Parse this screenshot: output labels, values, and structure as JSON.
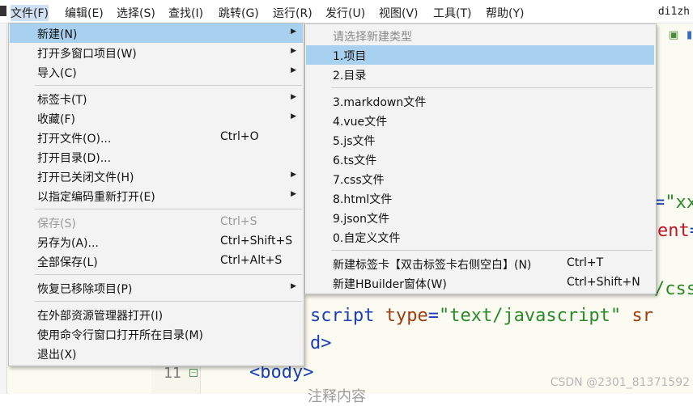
{
  "menubar": {
    "items": [
      {
        "label": "文件(F)"
      },
      {
        "label": "编辑(E)"
      },
      {
        "label": "选择(S)"
      },
      {
        "label": "查找(I)"
      },
      {
        "label": "跳转(G)"
      },
      {
        "label": "运行(R)"
      },
      {
        "label": "发行(U)"
      },
      {
        "label": "视图(V)"
      },
      {
        "label": "工具(T)"
      },
      {
        "label": "帮助(Y)"
      }
    ],
    "user": "di1zh"
  },
  "file_menu": {
    "items": [
      {
        "label": "新建(N)"
      },
      {
        "label": "打开多窗口项目(W)"
      },
      {
        "label": "导入(C)"
      },
      {
        "label": "标签卡(T)"
      },
      {
        "label": "收藏(F)"
      },
      {
        "label": "打开文件(O)...",
        "shortcut": "Ctrl+O"
      },
      {
        "label": "打开目录(D)..."
      },
      {
        "label": "打开已关闭文件(H)"
      },
      {
        "label": "以指定编码重新打开(E)"
      },
      {
        "label": "保存(S)",
        "shortcut": "Ctrl+S"
      },
      {
        "label": "另存为(A)...",
        "shortcut": "Ctrl+Shift+S"
      },
      {
        "label": "全部保存(L)",
        "shortcut": "Ctrl+Alt+S"
      },
      {
        "label": "恢复已移除项目(P)"
      },
      {
        "label": "在外部资源管理器打开(I)"
      },
      {
        "label": "使用命令行窗口打开所在目录(M)"
      },
      {
        "label": "退出(X)"
      }
    ]
  },
  "new_submenu": {
    "items": [
      {
        "label": "请选择新建类型"
      },
      {
        "label": "1.项目"
      },
      {
        "label": "2.目录"
      },
      {
        "label": "3.markdown文件"
      },
      {
        "label": "4.vue文件"
      },
      {
        "label": "5.js文件"
      },
      {
        "label": "6.ts文件"
      },
      {
        "label": "7.css文件"
      },
      {
        "label": "8.html文件"
      },
      {
        "label": "9.json文件"
      },
      {
        "label": "0.自定义文件"
      },
      {
        "label": "新建标签卡【双击标签卡右侧空白】(N)",
        "shortcut": "Ctrl+T"
      },
      {
        "label": "新建HBuilder窗体(W)",
        "shortcut": "Ctrl+Shift+N"
      }
    ]
  },
  "editor": {
    "frag_xx_eq": "=",
    "frag_xx_str": "\"xx",
    "frag_ent": "ent",
    "frag_ent_eq": "=",
    "frag_css": "/css",
    "script_kw": "script",
    "type_attr": "type",
    "type_eq": "=",
    "type_val": "\"text/javascript\"",
    "src_frag": "sr",
    "d_close": "d>",
    "line_number": "11",
    "body_tag": "<body>",
    "comment_frag": "注释内容"
  },
  "watermark": "CSDN @2301_81371592"
}
